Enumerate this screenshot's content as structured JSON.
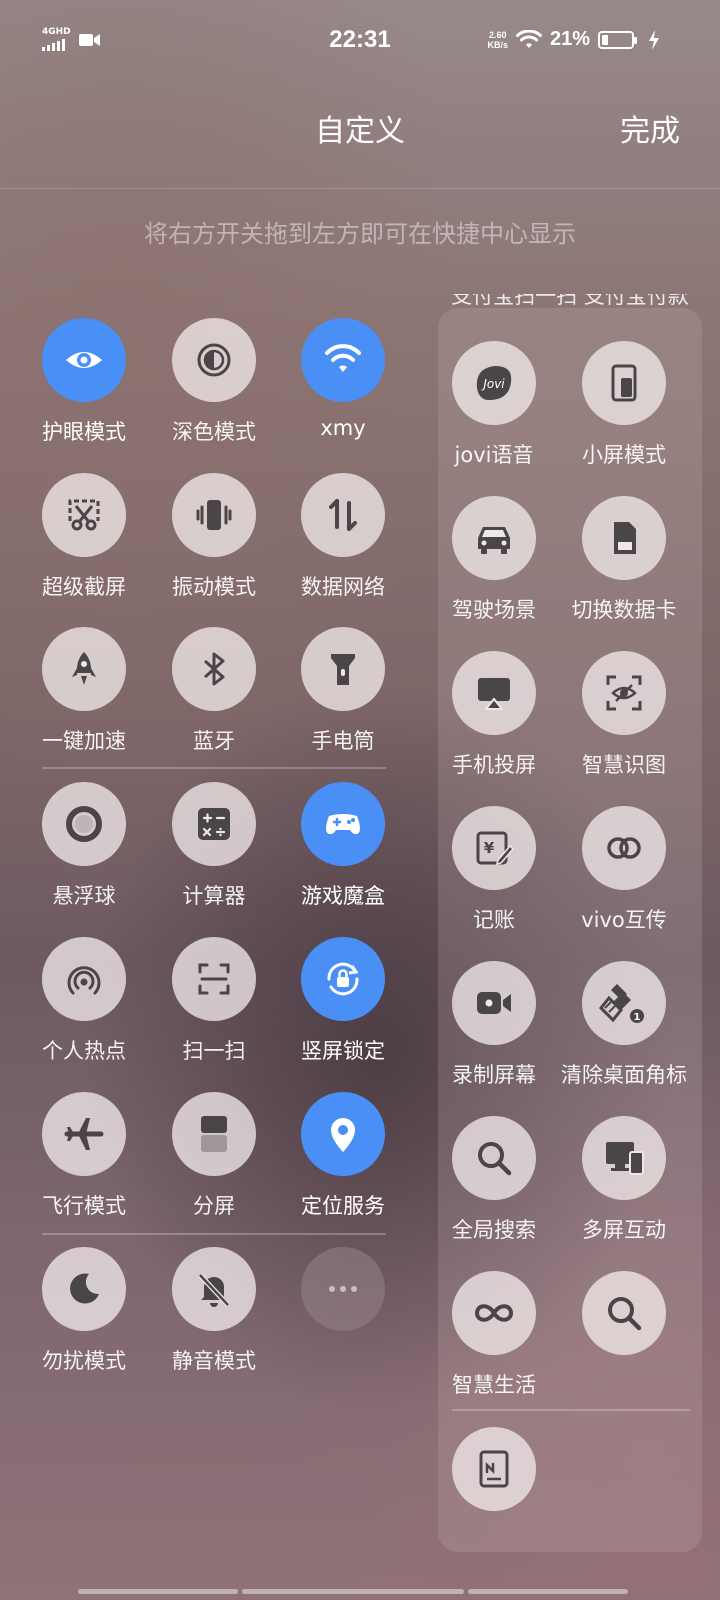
{
  "status_bar": {
    "network": "4GHD",
    "time": "22:31",
    "speed_value": "2.60",
    "speed_unit": "KB/s",
    "battery_text": "21%",
    "battery_level": 0.21
  },
  "header": {
    "title": "自定义",
    "done_label": "完成"
  },
  "hint": "将右方开关拖到左方即可在快捷中心显示",
  "panel_clipped_text": "支付宝扫一扫  支付宝付款",
  "accent_color": "#4a8ff5",
  "left_tiles": [
    {
      "label": "护眼模式",
      "icon": "eye-icon",
      "active": true
    },
    {
      "label": "深色模式",
      "icon": "dark-mode-icon",
      "active": false
    },
    {
      "label": "xmy",
      "icon": "wifi-icon",
      "active": true
    },
    {
      "label": "超级截屏",
      "icon": "screenshot-icon",
      "active": false
    },
    {
      "label": "振动模式",
      "icon": "vibrate-icon",
      "active": false
    },
    {
      "label": "数据网络",
      "icon": "mobile-data-icon",
      "active": false
    },
    {
      "label": "一键加速",
      "icon": "rocket-icon",
      "active": false
    },
    {
      "label": "蓝牙",
      "icon": "bluetooth-icon",
      "active": false
    },
    {
      "label": "手电筒",
      "icon": "flashlight-icon",
      "active": false
    },
    {
      "label": "悬浮球",
      "icon": "floating-ball-icon",
      "active": false
    },
    {
      "label": "计算器",
      "icon": "calculator-icon",
      "active": false
    },
    {
      "label": "游戏魔盒",
      "icon": "gamepad-icon",
      "active": true
    },
    {
      "label": "个人热点",
      "icon": "hotspot-icon",
      "active": false
    },
    {
      "label": "扫一扫",
      "icon": "scan-icon",
      "active": false
    },
    {
      "label": "竖屏锁定",
      "icon": "rotation-lock-icon",
      "active": true
    },
    {
      "label": "飞行模式",
      "icon": "airplane-icon",
      "active": false
    },
    {
      "label": "分屏",
      "icon": "split-screen-icon",
      "active": false
    },
    {
      "label": "定位服务",
      "icon": "location-icon",
      "active": true
    },
    {
      "label": "勿扰模式",
      "icon": "moon-icon",
      "active": false
    },
    {
      "label": "静音模式",
      "icon": "mute-bell-icon",
      "active": false
    },
    {
      "label": "",
      "icon": "more-icon",
      "active": false
    }
  ],
  "right_tiles": [
    {
      "label": "jovi语音",
      "icon": "jovi-icon",
      "icon_text": "Jovi"
    },
    {
      "label": "小屏模式",
      "icon": "small-screen-icon"
    },
    {
      "label": "驾驶场景",
      "icon": "car-icon"
    },
    {
      "label": "切换数据卡",
      "icon": "sim-card-icon"
    },
    {
      "label": "手机投屏",
      "icon": "screen-cast-icon"
    },
    {
      "label": "智慧识图",
      "icon": "image-recognition-icon"
    },
    {
      "label": "记账",
      "icon": "bookkeeping-icon"
    },
    {
      "label": "vivo互传",
      "icon": "vivo-share-icon"
    },
    {
      "label": "录制屏幕",
      "icon": "screen-record-icon"
    },
    {
      "label": "清除桌面角标",
      "icon": "clear-badge-icon",
      "badge": "1"
    },
    {
      "label": "全局搜索",
      "icon": "search-icon"
    },
    {
      "label": "多屏互动",
      "icon": "multi-screen-icon"
    },
    {
      "label": "智慧生活",
      "icon": "smart-life-icon"
    },
    {
      "label": "",
      "icon": "search-icon"
    },
    {
      "label": "",
      "icon": "document-icon"
    }
  ]
}
